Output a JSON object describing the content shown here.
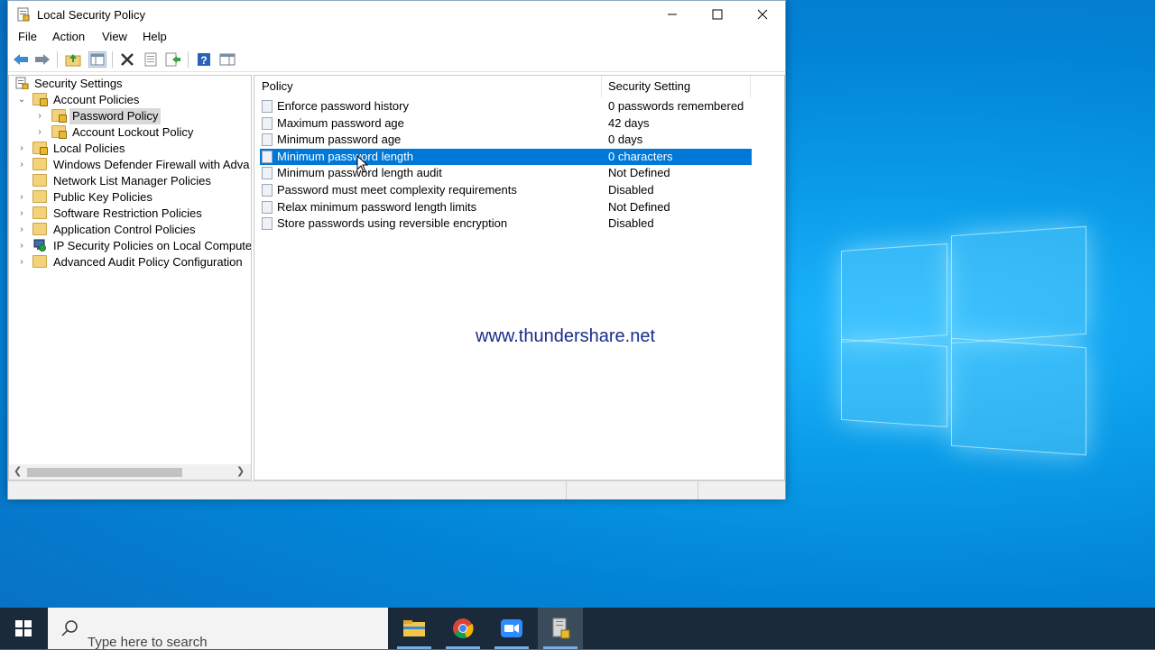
{
  "window": {
    "title": "Local Security Policy"
  },
  "menu": [
    "File",
    "Action",
    "View",
    "Help"
  ],
  "tree": [
    {
      "label": "Security Settings",
      "icon": "security-settings-icon"
    },
    {
      "label": "Account Policies",
      "icon": "folder-lock-icon"
    },
    {
      "label": "Password Policy",
      "icon": "folder-lock-icon"
    },
    {
      "label": "Account Lockout Policy",
      "icon": "folder-lock-icon"
    },
    {
      "label": "Local Policies",
      "icon": "folder-lock-icon"
    },
    {
      "label": "Windows Defender Firewall with Adva",
      "icon": "folder-icon"
    },
    {
      "label": "Network List Manager Policies",
      "icon": "folder-icon"
    },
    {
      "label": "Public Key Policies",
      "icon": "folder-icon"
    },
    {
      "label": "Software Restriction Policies",
      "icon": "folder-icon"
    },
    {
      "label": "Application Control Policies",
      "icon": "folder-icon"
    },
    {
      "label": "IP Security Policies on Local Compute",
      "icon": "ip-security-icon"
    },
    {
      "label": "Advanced Audit Policy Configuration",
      "icon": "folder-icon"
    }
  ],
  "list": {
    "columns": [
      "Policy",
      "Security Setting"
    ],
    "rows": [
      {
        "policy": "Enforce password history",
        "setting": "0 passwords remembered"
      },
      {
        "policy": "Maximum password age",
        "setting": "42 days"
      },
      {
        "policy": "Minimum password age",
        "setting": "0 days"
      },
      {
        "policy": "Minimum password length",
        "setting": "0 characters"
      },
      {
        "policy": "Minimum password length audit",
        "setting": "Not Defined"
      },
      {
        "policy": "Password must meet complexity requirements",
        "setting": "Disabled"
      },
      {
        "policy": "Relax minimum password length limits",
        "setting": "Not Defined"
      },
      {
        "policy": "Store passwords using reversible encryption",
        "setting": "Disabled"
      }
    ],
    "selected_row": 3
  },
  "watermark": "www.thundershare.net",
  "taskbar": {
    "search_placeholder": "Type here to search",
    "apps": [
      "file-explorer-icon",
      "chrome-icon",
      "zoom-icon",
      "local-security-policy-icon"
    ]
  },
  "colors": {
    "accent": "#0078d7",
    "taskbar": "#1b2a3a"
  }
}
